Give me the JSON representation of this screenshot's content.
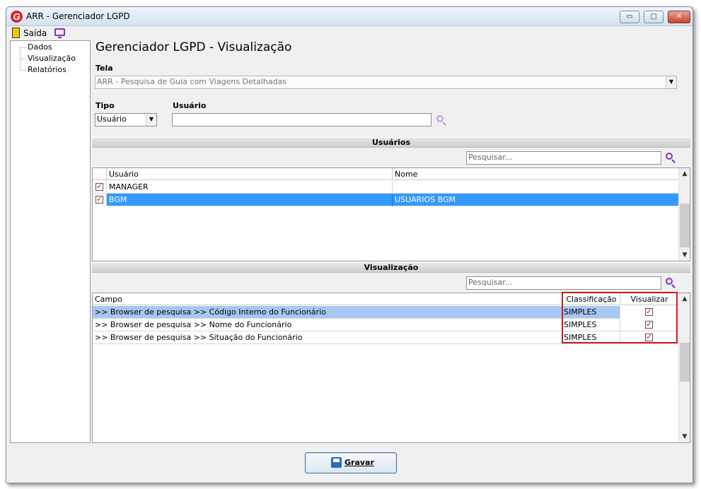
{
  "window": {
    "title": "ARR - Gerenciador LGPD",
    "app_icon_letter": "G",
    "controls": {
      "minimize": "▭",
      "maximize": "□",
      "close": "✕"
    }
  },
  "menu": {
    "exit_label": "Saída",
    "exit_icon": "exit-door-icon",
    "monitor_icon": "monitor-icon"
  },
  "sidebar": {
    "items": [
      {
        "label": "Dados"
      },
      {
        "label": "Visualização"
      },
      {
        "label": "Relatórios"
      }
    ]
  },
  "main": {
    "title": "Gerenciador LGPD - Visualização",
    "tela_label": "Tela",
    "tela_value": "ARR - Pesquisa de Guia com Viagens Detalhadas",
    "tipo_label": "Tipo",
    "tipo_value": "Usuário",
    "usuario_label": "Usuário",
    "usuario_value": ""
  },
  "users_section": {
    "title": "Usuários",
    "search_placeholder": "Pesquisar...",
    "columns": [
      "Usuário",
      "Nome"
    ],
    "rows": [
      {
        "checked": true,
        "usuario": "MANAGER",
        "nome": ""
      },
      {
        "checked": true,
        "usuario": "BGM",
        "nome": "USUARIOS BGM",
        "selected": true
      }
    ]
  },
  "view_section": {
    "title": "Visualização",
    "search_placeholder": "Pesquisar...",
    "columns": [
      "Campo",
      "Classificação",
      "Visualizar"
    ],
    "rows": [
      {
        "campo": ">> Browser de pesquisa >> Código Interno do Funcionário",
        "classificacao": "SIMPLES",
        "visualizar": true
      },
      {
        "campo": ">> Browser de pesquisa >> Nome do Funcionário",
        "classificacao": "SIMPLES",
        "visualizar": true
      },
      {
        "campo": ">> Browser de pesquisa >> Situação do Funcionário",
        "classificacao": "SIMPLES",
        "visualizar": true
      }
    ]
  },
  "footer": {
    "save_label": "Gravar"
  },
  "colors": {
    "accent": "#8b2bc4",
    "selection": "#3399ff",
    "highlight": "#d11a1a",
    "check": "#d10000"
  }
}
